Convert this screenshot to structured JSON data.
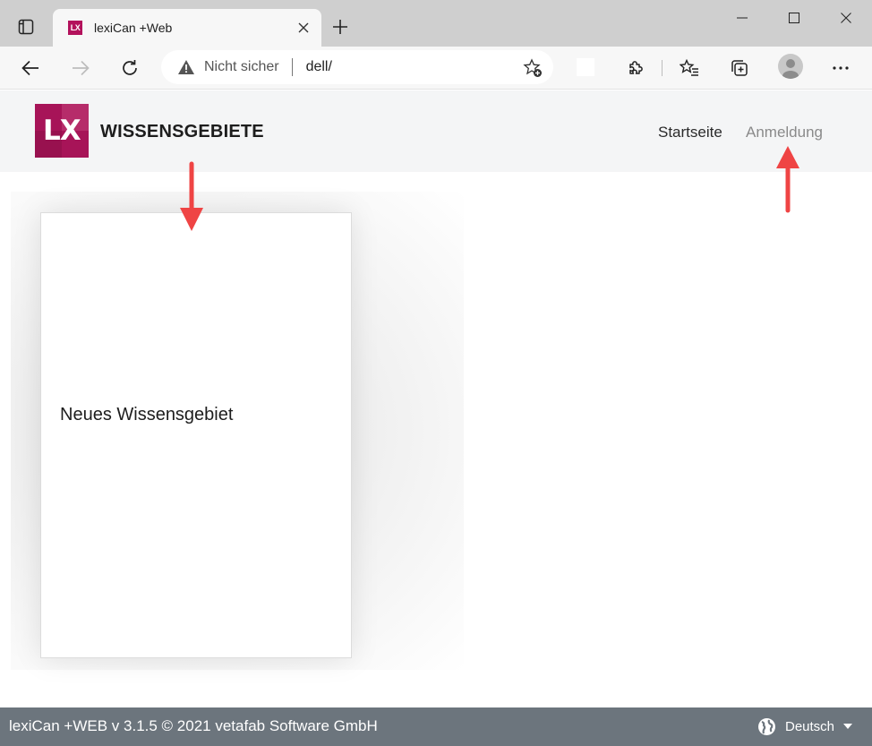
{
  "browser": {
    "tab_title": "lexiCan +Web",
    "favicon_text": "LX",
    "omnibox": {
      "security_label": "Nicht sicher",
      "url": "dell/"
    }
  },
  "header": {
    "logo_text": "LX",
    "brand_title": "WISSENSGEBIETE",
    "nav": {
      "home": "Startseite",
      "login": "Anmeldung"
    }
  },
  "main": {
    "cards": [
      {
        "label": "Neues Wissensgebiet"
      }
    ]
  },
  "footer": {
    "copyright": "lexiCan +WEB v 3.1.5  © 2021 vetafab Software GmbH",
    "language": "Deutsch"
  },
  "colors": {
    "brand": "#a71458",
    "annotation_arrow": "#ef4444",
    "footer_bg": "#6c757d"
  }
}
